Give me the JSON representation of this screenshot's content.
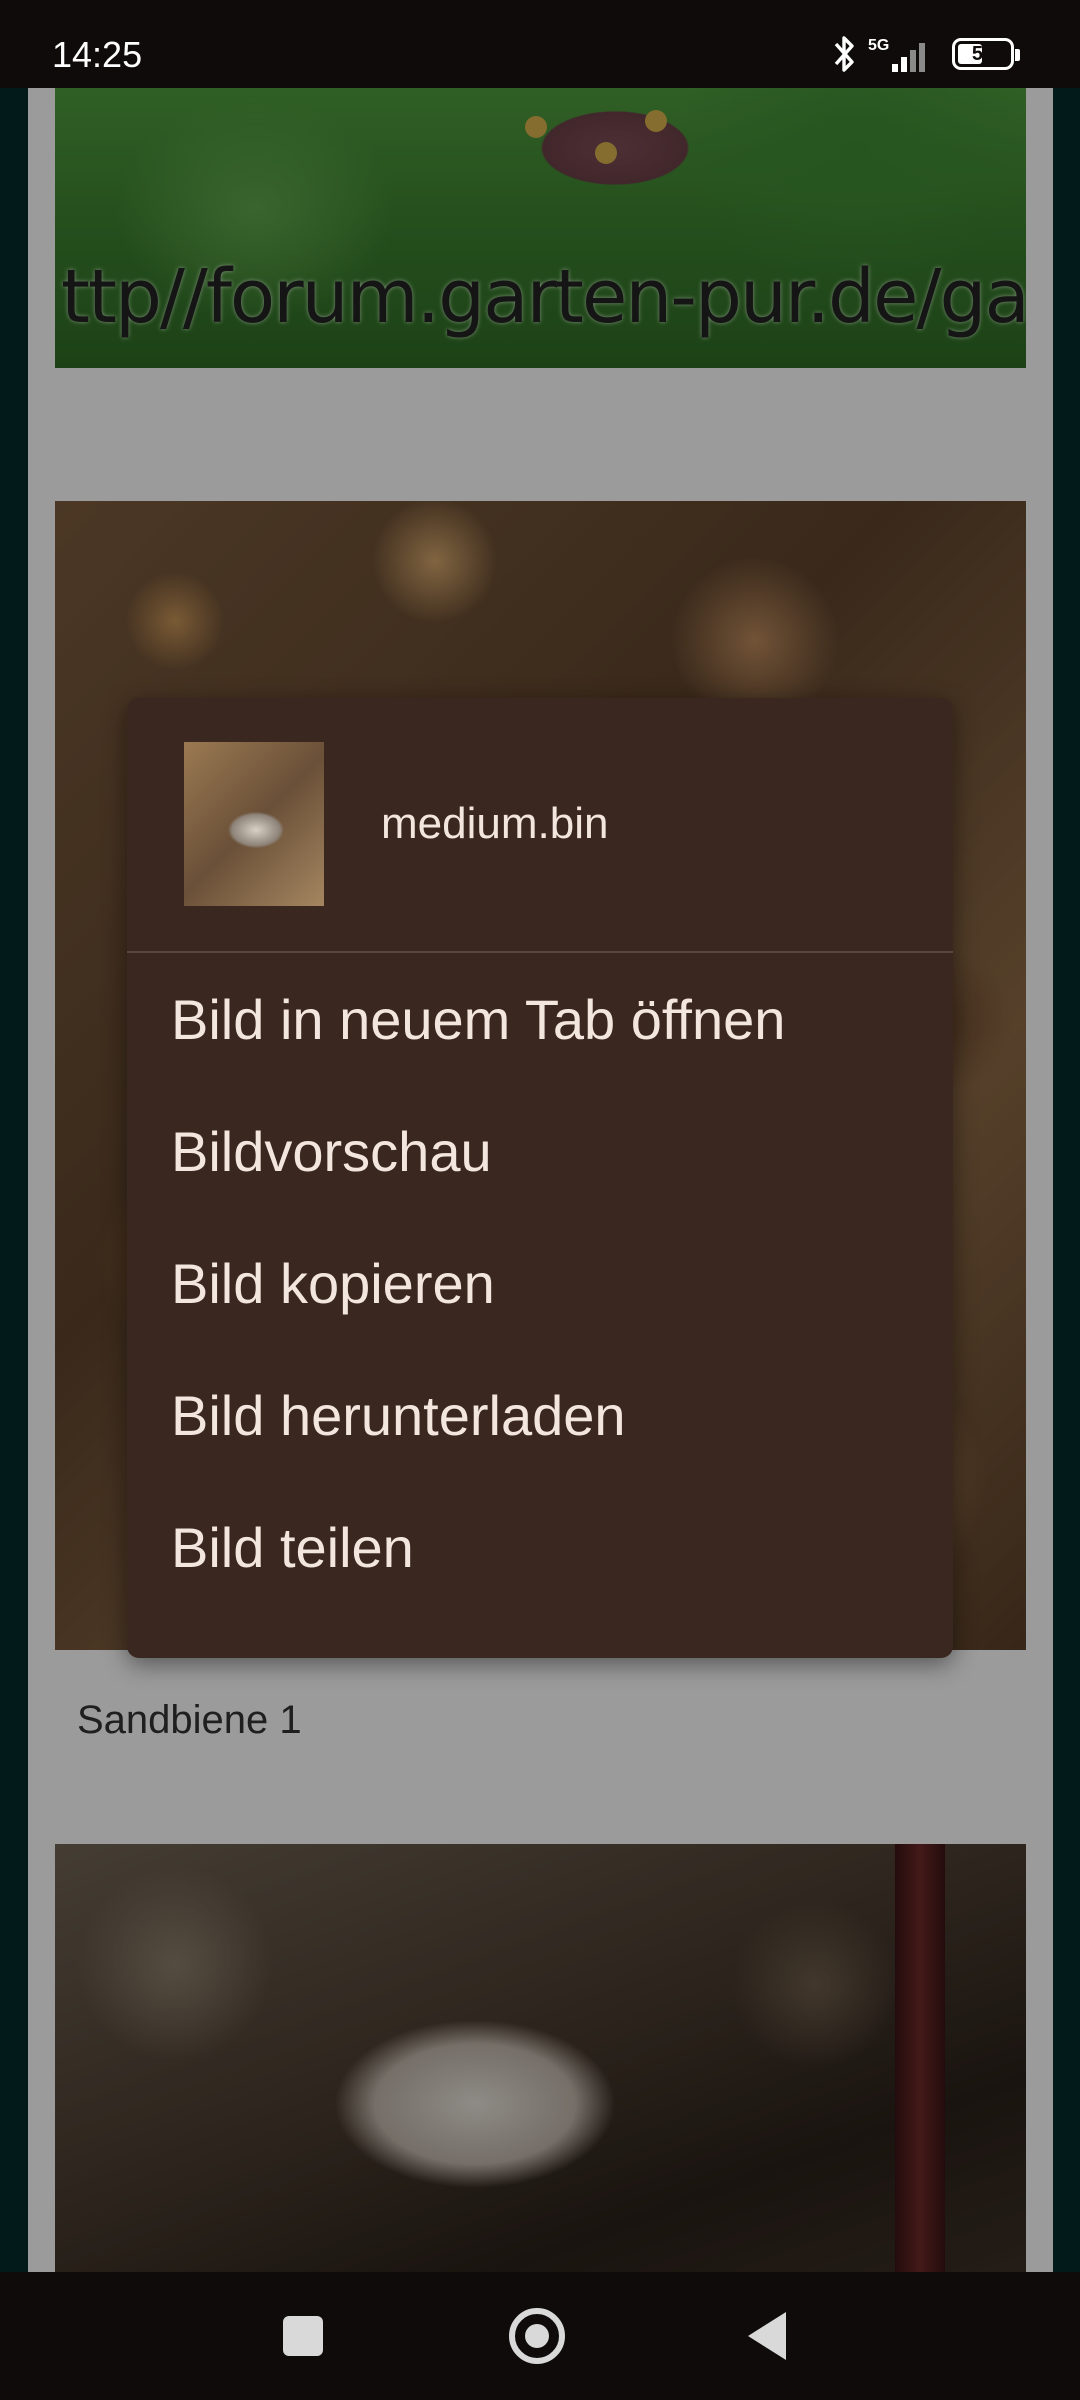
{
  "status_bar": {
    "time": "14:25",
    "network": "5G",
    "battery_level": "54",
    "battery_percent": 54,
    "icons": [
      "bluetooth-icon",
      "signal-icon",
      "battery-icon"
    ]
  },
  "page": {
    "watermark": "ttp//forum.garten-pur.de/gale",
    "caption": "Sandbiene 1"
  },
  "context_menu": {
    "file_name": "medium.bin",
    "items": [
      {
        "label": "Bild in neuem Tab öffnen"
      },
      {
        "label": "Bildvorschau"
      },
      {
        "label": "Bild kopieren"
      },
      {
        "label": "Bild herunterladen"
      },
      {
        "label": "Bild teilen"
      }
    ]
  },
  "nav_bar": {
    "icons": [
      "recents-icon",
      "home-icon",
      "back-icon"
    ]
  },
  "colors": {
    "menu_background": "#3a2720",
    "menu_text": "#f3e6df",
    "status_bar": "#100b0b"
  }
}
